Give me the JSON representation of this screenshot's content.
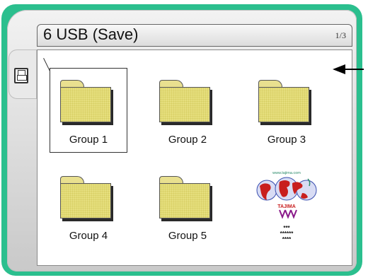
{
  "title_bar": {
    "title": "6 USB (Save)",
    "page_indicator": "1/3"
  },
  "side_tab": {
    "icon": "floppy-disk-icon"
  },
  "grid": {
    "items": [
      {
        "label": "Group 1",
        "icon": "folder-icon",
        "selected": true
      },
      {
        "label": "Group 2",
        "icon": "folder-icon"
      },
      {
        "label": "Group 3",
        "icon": "folder-icon"
      },
      {
        "label": "Group 4",
        "icon": "folder-icon"
      },
      {
        "label": "Group 5",
        "icon": "folder-icon"
      }
    ],
    "logo_item": {
      "url_text": "www.tajima.com",
      "brand": "TAJIMA",
      "stars": [
        "***",
        "******",
        "****"
      ]
    }
  },
  "colors": {
    "frame": "#2bbf8e",
    "folder": "#e6df7e",
    "map_red": "#c81e1e",
    "map_blue": "#3a4fb0"
  }
}
